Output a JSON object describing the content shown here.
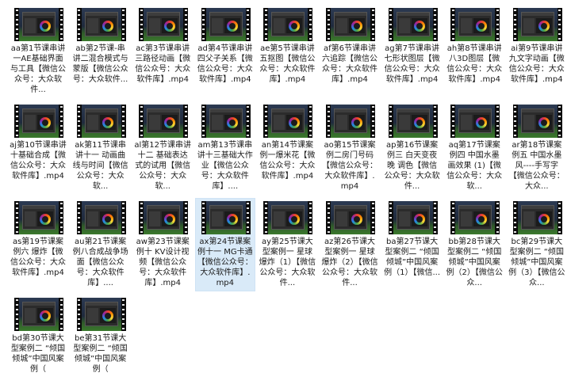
{
  "files": [
    {
      "name": "aa第1节课串讲一AE基础界面与工具【微信公众号：大众软件..."
    },
    {
      "name": "ab第2节课-串讲二混合模式与蒙版【微信公众号：大众软件..."
    },
    {
      "name": "ac第3节课串讲三路径动画【微信公众号：大众软件库】.mp4"
    },
    {
      "name": "ad第4节课串讲四父子关系【微信公众号：大众软件库】.mp4"
    },
    {
      "name": "ae第5节课串讲五抠图【微信公众号：大众软件库】.mp4"
    },
    {
      "name": "af第6节课串讲六追踪【微信公众号：大众软件库】.mp4"
    },
    {
      "name": "ag第7节课串讲七形状图层【微信公众号：大众软件库】.mp4"
    },
    {
      "name": "ah第8节课串讲八3D图层【微信公众号：大众软件库】.mp4"
    },
    {
      "name": "ai第9节课串讲九文字动画【微信公众号：大众软件库】.mp4"
    },
    {
      "name": "aj第10节课串讲十基础合成【微信公众号：大众软件库】.mp4"
    },
    {
      "name": "ak第11节课串讲十一 动画曲线与时间【微信公众号：大众软..."
    },
    {
      "name": "al第12节课串讲十二 基础表达式的试用【微信公众号：大众软..."
    },
    {
      "name": "am第13节课串讲十三基础大作业【微信公众号：大众软件库】...."
    },
    {
      "name": "an第14节课案例一爆米花【微信公众号：大众软件库】.mp4"
    },
    {
      "name": "ao第15节课案例二房门号码【微信公众号：大众软件库】.mp4"
    },
    {
      "name": "ap第16节课案例三 白天变夜晚 调色【微信公众号：大众软件..."
    },
    {
      "name": "aq第17节课案例四 中国水墨画效果 (1)【微信公众号：大众软..."
    },
    {
      "name": "ar第18节课案例五 中国水墨风----手写字【微信公众号：大众..."
    },
    {
      "name": "as第19节课案例六 爆炸【微信公众号：大众软件库】.mp4"
    },
    {
      "name": "au第21节课案例八合成战争场面【微信公众号：大众软件库】...."
    },
    {
      "name": "aw第23节课案例十 KV设计视频【微信公众号：大众软件库】.mp4"
    },
    {
      "name": "ax第24节课案例十一 MG卡通【微信公众号：大众软件库】.mp4"
    },
    {
      "name": "ay第25节课大型案例一 星球爆炸（1）【微信公众号：大众软件..."
    },
    {
      "name": "az第26节课大型案例一 星球爆炸（2）【微信公众号：大众软件..."
    },
    {
      "name": "ba第27节课大型案例二 “倾国倾城”中国风案例（1）【微信..."
    },
    {
      "name": "bb第28节课大型案例二 “倾国倾城”中国风案例（2）【微信公众..."
    },
    {
      "name": "bc第29节课大型案例二 “倾国倾城”中国风案例（3）【微信公众..."
    },
    {
      "name": "bd第30节课大型案例二 “倾国倾城”中国风案例（"
    },
    {
      "name": "be第31节课大型案例二 “倾国倾城”中国风案例（"
    }
  ],
  "selected_index": 21
}
